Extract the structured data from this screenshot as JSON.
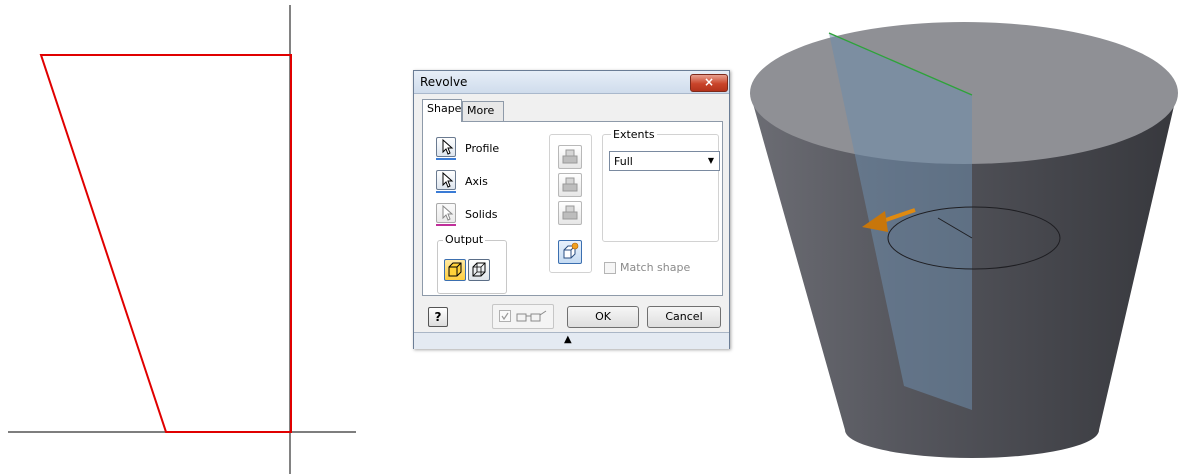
{
  "dialog": {
    "title": "Revolve",
    "close_icon": "×",
    "tabs": [
      {
        "label": "Shape",
        "active": true
      },
      {
        "label": "More",
        "active": false
      }
    ],
    "selectors": [
      {
        "label": "Profile",
        "underline_color": "#3a7bd5"
      },
      {
        "label": "Axis",
        "underline_color": "#3a7bd5"
      },
      {
        "label": "Solids",
        "underline_color": "#c0309a"
      }
    ],
    "output": {
      "label": "Output",
      "buttons": [
        "solid-output-icon",
        "surface-output-icon"
      ]
    },
    "extents": {
      "label": "Extents",
      "selected": "Full"
    },
    "match_shape": {
      "label": "Match shape",
      "checked": false,
      "enabled": false
    },
    "footer": {
      "help_icon": "?",
      "ok": "OK",
      "cancel": "Cancel",
      "expand_icon": "▲"
    }
  },
  "colors": {
    "profile_line": "#e00000",
    "axis_line": "#303030",
    "cone_body": "#56575e",
    "cone_top": "#8f9095",
    "preview_plane": "#6e8cab",
    "direction_arrow": "#e08a10"
  }
}
